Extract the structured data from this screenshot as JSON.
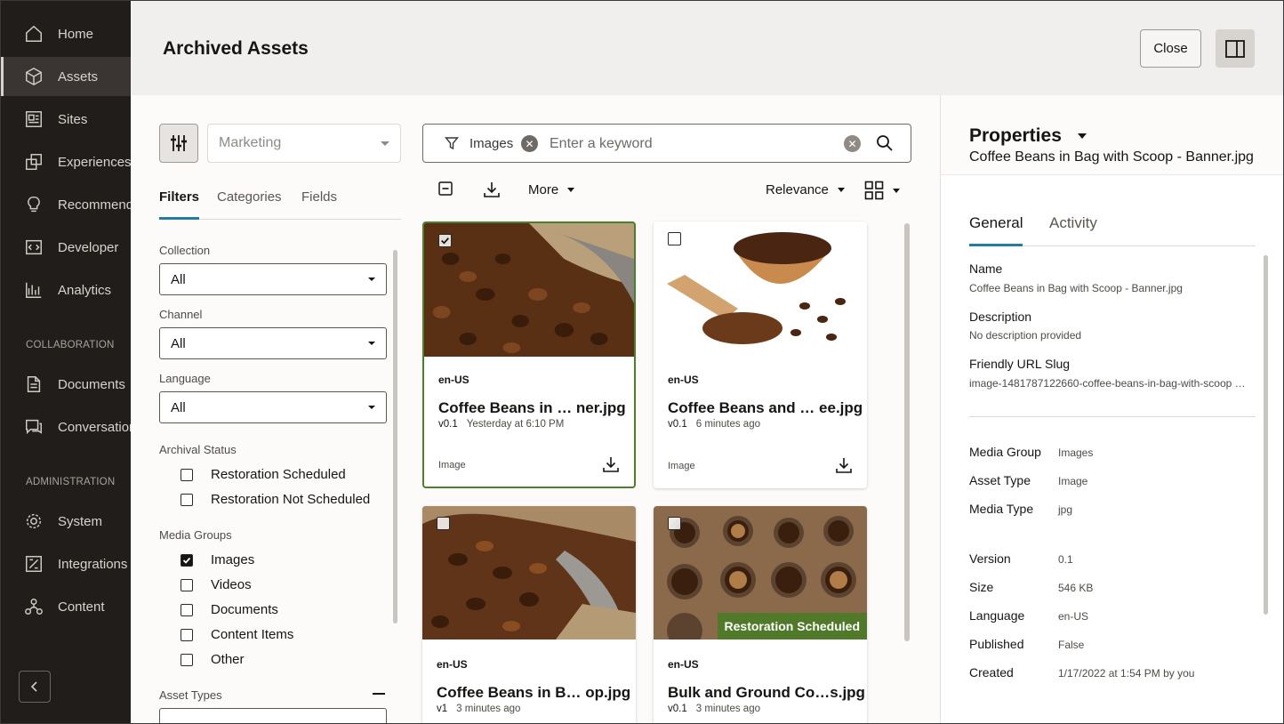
{
  "sidebar": {
    "items": [
      {
        "label": "Home",
        "icon": "home-icon"
      },
      {
        "label": "Assets",
        "icon": "cube-icon"
      },
      {
        "label": "Sites",
        "icon": "sites-icon"
      },
      {
        "label": "Experiences",
        "icon": "experiences-icon"
      },
      {
        "label": "Recommendations",
        "icon": "lightbulb-icon"
      },
      {
        "label": "Developer",
        "icon": "code-icon"
      },
      {
        "label": "Analytics",
        "icon": "analytics-icon"
      },
      {
        "label": "Documents",
        "icon": "document-icon"
      },
      {
        "label": "Conversations",
        "icon": "conversation-icon"
      },
      {
        "label": "System",
        "icon": "gear-icon"
      },
      {
        "label": "Integrations",
        "icon": "integrations-icon"
      },
      {
        "label": "Content",
        "icon": "content-icon"
      }
    ],
    "section_collaboration": "COLLABORATION",
    "section_administration": "ADMINISTRATION",
    "active_item": "Assets"
  },
  "header": {
    "title": "Archived Assets",
    "close_label": "Close"
  },
  "filters": {
    "repository": "Marketing",
    "tabs": [
      "Filters",
      "Categories",
      "Fields"
    ],
    "collection_label": "Collection",
    "collection_value": "All",
    "channel_label": "Channel",
    "channel_value": "All",
    "language_label": "Language",
    "language_value": "All",
    "archival_status_label": "Archival Status",
    "archival_status_options": [
      {
        "label": "Restoration Scheduled",
        "checked": false
      },
      {
        "label": "Restoration Not Scheduled",
        "checked": false
      }
    ],
    "media_groups_label": "Media Groups",
    "media_groups_options": [
      {
        "label": "Images",
        "checked": true
      },
      {
        "label": "Videos",
        "checked": false
      },
      {
        "label": "Documents",
        "checked": false
      },
      {
        "label": "Content Items",
        "checked": false
      },
      {
        "label": "Other",
        "checked": false
      }
    ],
    "asset_types_label": "Asset Types"
  },
  "search": {
    "chip": "Images",
    "placeholder": "Enter a keyword"
  },
  "toolbar": {
    "more_label": "More",
    "sort_label": "Relevance"
  },
  "cards": [
    {
      "lang": "en-US",
      "title": "Coffee Beans in … ner.jpg",
      "version": "v0.1",
      "time": "Yesterday at 6:10 PM",
      "type": "Image",
      "selected": true,
      "badge": ""
    },
    {
      "lang": "en-US",
      "title": "Coffee Beans and … ee.jpg",
      "version": "v0.1",
      "time": "6 minutes ago",
      "type": "Image",
      "selected": false,
      "badge": ""
    },
    {
      "lang": "en-US",
      "title": "Coffee Beans in B… op.jpg",
      "version": "v1",
      "time": "3 minutes ago",
      "type": "Image",
      "selected": false,
      "badge": ""
    },
    {
      "lang": "en-US",
      "title": "Bulk and Ground Co…s.jpg",
      "version": "v0.1",
      "time": "3 minutes ago",
      "type": "Image",
      "selected": false,
      "badge": "Restoration Scheduled"
    }
  ],
  "properties": {
    "title": "Properties",
    "file_name": "Coffee Beans in Bag with Scoop - Banner.jpg",
    "tabs": [
      "General",
      "Activity"
    ],
    "name_label": "Name",
    "name_value": "Coffee Beans in Bag with Scoop - Banner.jpg",
    "description_label": "Description",
    "description_value": "No description provided",
    "slug_label": "Friendly URL Slug",
    "slug_value": "image-1481787122660-coffee-beans-in-bag-with-scoop …",
    "rows": [
      {
        "label": "Media Group",
        "value": "Images"
      },
      {
        "label": "Asset Type",
        "value": "Image"
      },
      {
        "label": "Media Type",
        "value": "jpg"
      },
      {
        "label": "Version",
        "value": "0.1"
      },
      {
        "label": "Size",
        "value": "546 KB"
      },
      {
        "label": "Language",
        "value": "en-US"
      },
      {
        "label": "Published",
        "value": "False"
      },
      {
        "label": "Created",
        "value": "1/17/2022 at 1:54 PM by you"
      }
    ]
  },
  "colors": {
    "sidebar_bg": "#201d1b",
    "header_bg": "#f1efed",
    "accent_tab": "#227e9e",
    "selected_card_border": "#4a7f2c",
    "badge_bg": "#507a2a"
  }
}
